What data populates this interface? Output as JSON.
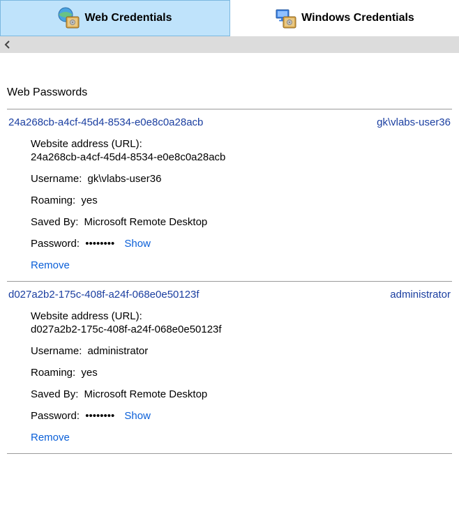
{
  "tabs": {
    "web": "Web Credentials",
    "windows": "Windows Credentials"
  },
  "section_title": "Web Passwords",
  "labels": {
    "url": "Website address (URL):",
    "username": "Username:",
    "roaming": "Roaming:",
    "saved_by": "Saved By:",
    "password": "Password:",
    "show": "Show",
    "remove": "Remove"
  },
  "entries": [
    {
      "site": "24a268cb-a4cf-45d4-8534-e0e8c0a28acb",
      "user_short": "gk\\vlabs-user36",
      "url": "24a268cb-a4cf-45d4-8534-e0e8c0a28acb",
      "username": "gk\\vlabs-user36",
      "roaming": "yes",
      "saved_by": "Microsoft Remote Desktop",
      "password_mask": "••••••••"
    },
    {
      "site": "d027a2b2-175c-408f-a24f-068e0e50123f",
      "user_short": "administrator",
      "url": "d027a2b2-175c-408f-a24f-068e0e50123f",
      "username": "administrator",
      "roaming": "yes",
      "saved_by": "Microsoft Remote Desktop",
      "password_mask": "••••••••"
    }
  ]
}
